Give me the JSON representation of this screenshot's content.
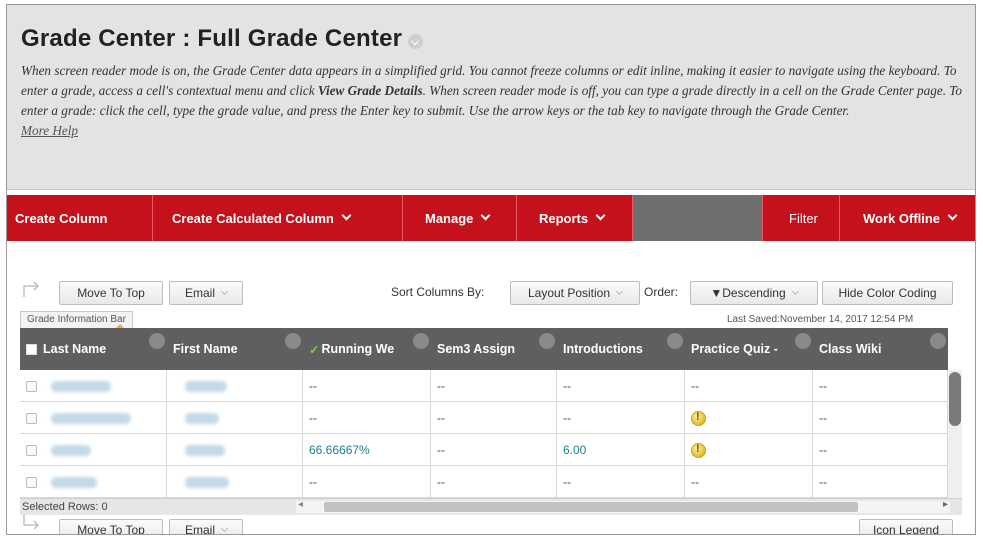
{
  "header": {
    "title": "Grade Center : Full Grade Center",
    "help_part1": "When screen reader mode is on, the Grade Center data appears in a simplified grid. You cannot freeze columns or edit inline, making it easier to navigate using the keyboard. To enter a grade, access a cell's contextual menu and click ",
    "help_bold": "View Grade Details",
    "help_part2": ". When screen reader mode is off, you can type a grade directly in a cell on the Grade Center page. To enter a grade: click the cell, type the grade value, and press the Enter key to submit. Use the arrow keys or the tab key to navigate through the Grade Center.",
    "more_help": "More Help"
  },
  "toolbar": {
    "create_column": "Create Column",
    "create_calculated_column": "Create Calculated Column",
    "manage": "Manage",
    "reports": "Reports",
    "filter": "Filter",
    "work_offline": "Work Offline"
  },
  "controls": {
    "move_to_top": "Move To Top",
    "email": "Email",
    "sort_columns_by_label": "Sort Columns By:",
    "sort_columns_by_value": "Layout Position",
    "order_label": "Order:",
    "order_value": "▼Descending",
    "hide_color_coding": "Hide Color Coding",
    "grade_information_bar": "Grade Information Bar",
    "last_saved": "Last Saved:November 14, 2017 12:54 PM"
  },
  "grid": {
    "columns": [
      "Last Name",
      "First Name",
      "Running We",
      "Sem3 Assign",
      "Introductions",
      "Practice Quiz -",
      "Class Wiki"
    ],
    "rows": [
      {
        "running": "--",
        "sem3": "--",
        "intro": "--",
        "quiz": "--",
        "quiz_warning": false,
        "wiki": "--"
      },
      {
        "running": "--",
        "sem3": "--",
        "intro": "--",
        "quiz": "",
        "quiz_warning": true,
        "wiki": "--"
      },
      {
        "running": "66.66667%",
        "sem3": "--",
        "intro": "6.00",
        "quiz": "",
        "quiz_warning": true,
        "wiki": "--"
      },
      {
        "running": "--",
        "sem3": "--",
        "intro": "--",
        "quiz": "--",
        "quiz_warning": false,
        "wiki": "--"
      }
    ]
  },
  "footer": {
    "selected_rows": "Selected Rows: 0",
    "move_to_top": "Move To Top",
    "email": "Email",
    "icon_legend": "Icon Legend"
  },
  "colors": {
    "toolbar_red": "#c5111b",
    "grid_header": "#5f5f5f",
    "link_teal": "#1a7f8f"
  },
  "icons": [
    "chevron-down-icon",
    "up-arrow-icon",
    "checkmark-icon",
    "warning-icon",
    "column-options-icon"
  ]
}
